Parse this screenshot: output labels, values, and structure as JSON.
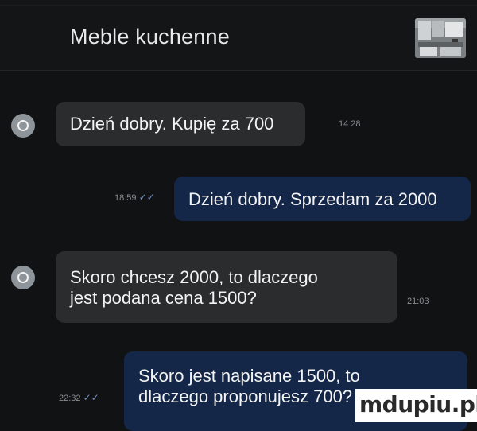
{
  "header": {
    "title": "Meble kuchenne",
    "thumbnail_icon": "kitchen-furniture-photo"
  },
  "messages": [
    {
      "direction": "incoming",
      "lines": [
        "Dzień dobry. Kupię za 700"
      ],
      "time": "14:28"
    },
    {
      "direction": "outgoing",
      "lines": [
        "Dzień dobry. Sprzedam za 2000"
      ],
      "time": "18:59",
      "status": "read"
    },
    {
      "direction": "incoming",
      "lines": [
        "Skoro chcesz 2000, to dlaczego",
        "jest podana cena 1500?"
      ],
      "time": "21:03"
    },
    {
      "direction": "outgoing",
      "lines": [
        "Skoro jest napisane 1500, to",
        "dlaczego proponujesz 700?"
      ],
      "time": "22:32",
      "status": "read"
    }
  ],
  "watermark": "mdupiu.pl",
  "colors": {
    "background": "#111213",
    "incoming_bubble": "#2a2c2e",
    "outgoing_bubble": "#142748",
    "avatar": "#8d949a"
  }
}
